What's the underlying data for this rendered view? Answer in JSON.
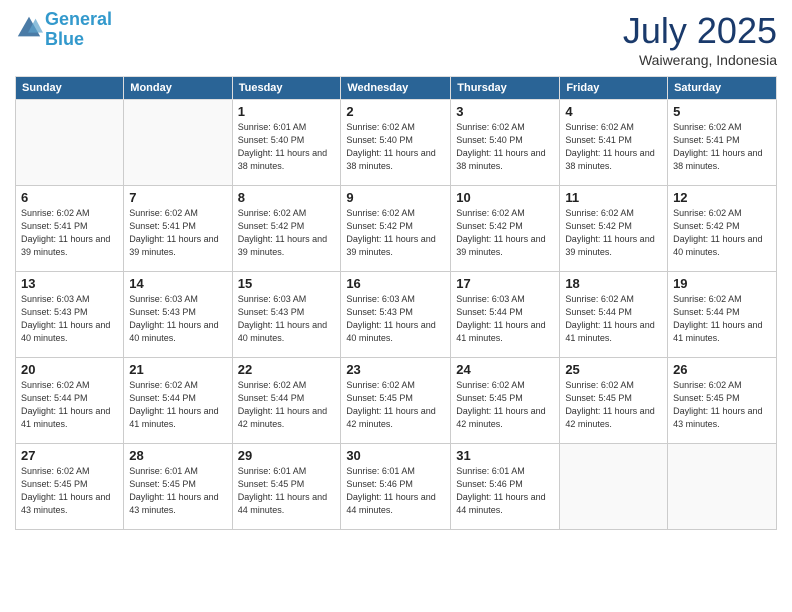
{
  "logo": {
    "line1": "General",
    "line2": "Blue"
  },
  "title": "July 2025",
  "location": "Waiwerang, Indonesia",
  "days_of_week": [
    "Sunday",
    "Monday",
    "Tuesday",
    "Wednesday",
    "Thursday",
    "Friday",
    "Saturday"
  ],
  "weeks": [
    [
      {
        "num": "",
        "info": ""
      },
      {
        "num": "",
        "info": ""
      },
      {
        "num": "1",
        "info": "Sunrise: 6:01 AM\nSunset: 5:40 PM\nDaylight: 11 hours and 38 minutes."
      },
      {
        "num": "2",
        "info": "Sunrise: 6:02 AM\nSunset: 5:40 PM\nDaylight: 11 hours and 38 minutes."
      },
      {
        "num": "3",
        "info": "Sunrise: 6:02 AM\nSunset: 5:40 PM\nDaylight: 11 hours and 38 minutes."
      },
      {
        "num": "4",
        "info": "Sunrise: 6:02 AM\nSunset: 5:41 PM\nDaylight: 11 hours and 38 minutes."
      },
      {
        "num": "5",
        "info": "Sunrise: 6:02 AM\nSunset: 5:41 PM\nDaylight: 11 hours and 38 minutes."
      }
    ],
    [
      {
        "num": "6",
        "info": "Sunrise: 6:02 AM\nSunset: 5:41 PM\nDaylight: 11 hours and 39 minutes."
      },
      {
        "num": "7",
        "info": "Sunrise: 6:02 AM\nSunset: 5:41 PM\nDaylight: 11 hours and 39 minutes."
      },
      {
        "num": "8",
        "info": "Sunrise: 6:02 AM\nSunset: 5:42 PM\nDaylight: 11 hours and 39 minutes."
      },
      {
        "num": "9",
        "info": "Sunrise: 6:02 AM\nSunset: 5:42 PM\nDaylight: 11 hours and 39 minutes."
      },
      {
        "num": "10",
        "info": "Sunrise: 6:02 AM\nSunset: 5:42 PM\nDaylight: 11 hours and 39 minutes."
      },
      {
        "num": "11",
        "info": "Sunrise: 6:02 AM\nSunset: 5:42 PM\nDaylight: 11 hours and 39 minutes."
      },
      {
        "num": "12",
        "info": "Sunrise: 6:02 AM\nSunset: 5:42 PM\nDaylight: 11 hours and 40 minutes."
      }
    ],
    [
      {
        "num": "13",
        "info": "Sunrise: 6:03 AM\nSunset: 5:43 PM\nDaylight: 11 hours and 40 minutes."
      },
      {
        "num": "14",
        "info": "Sunrise: 6:03 AM\nSunset: 5:43 PM\nDaylight: 11 hours and 40 minutes."
      },
      {
        "num": "15",
        "info": "Sunrise: 6:03 AM\nSunset: 5:43 PM\nDaylight: 11 hours and 40 minutes."
      },
      {
        "num": "16",
        "info": "Sunrise: 6:03 AM\nSunset: 5:43 PM\nDaylight: 11 hours and 40 minutes."
      },
      {
        "num": "17",
        "info": "Sunrise: 6:03 AM\nSunset: 5:44 PM\nDaylight: 11 hours and 41 minutes."
      },
      {
        "num": "18",
        "info": "Sunrise: 6:02 AM\nSunset: 5:44 PM\nDaylight: 11 hours and 41 minutes."
      },
      {
        "num": "19",
        "info": "Sunrise: 6:02 AM\nSunset: 5:44 PM\nDaylight: 11 hours and 41 minutes."
      }
    ],
    [
      {
        "num": "20",
        "info": "Sunrise: 6:02 AM\nSunset: 5:44 PM\nDaylight: 11 hours and 41 minutes."
      },
      {
        "num": "21",
        "info": "Sunrise: 6:02 AM\nSunset: 5:44 PM\nDaylight: 11 hours and 41 minutes."
      },
      {
        "num": "22",
        "info": "Sunrise: 6:02 AM\nSunset: 5:44 PM\nDaylight: 11 hours and 42 minutes."
      },
      {
        "num": "23",
        "info": "Sunrise: 6:02 AM\nSunset: 5:45 PM\nDaylight: 11 hours and 42 minutes."
      },
      {
        "num": "24",
        "info": "Sunrise: 6:02 AM\nSunset: 5:45 PM\nDaylight: 11 hours and 42 minutes."
      },
      {
        "num": "25",
        "info": "Sunrise: 6:02 AM\nSunset: 5:45 PM\nDaylight: 11 hours and 42 minutes."
      },
      {
        "num": "26",
        "info": "Sunrise: 6:02 AM\nSunset: 5:45 PM\nDaylight: 11 hours and 43 minutes."
      }
    ],
    [
      {
        "num": "27",
        "info": "Sunrise: 6:02 AM\nSunset: 5:45 PM\nDaylight: 11 hours and 43 minutes."
      },
      {
        "num": "28",
        "info": "Sunrise: 6:01 AM\nSunset: 5:45 PM\nDaylight: 11 hours and 43 minutes."
      },
      {
        "num": "29",
        "info": "Sunrise: 6:01 AM\nSunset: 5:45 PM\nDaylight: 11 hours and 44 minutes."
      },
      {
        "num": "30",
        "info": "Sunrise: 6:01 AM\nSunset: 5:46 PM\nDaylight: 11 hours and 44 minutes."
      },
      {
        "num": "31",
        "info": "Sunrise: 6:01 AM\nSunset: 5:46 PM\nDaylight: 11 hours and 44 minutes."
      },
      {
        "num": "",
        "info": ""
      },
      {
        "num": "",
        "info": ""
      }
    ]
  ]
}
